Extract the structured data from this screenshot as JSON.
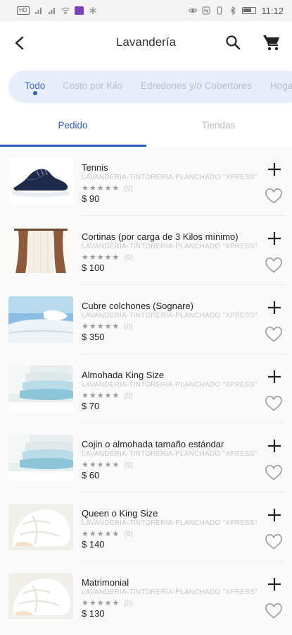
{
  "status_bar": {
    "left_badge": "HD",
    "time": "11:12"
  },
  "header": {
    "title": "Lavandería",
    "back_icon": "chevron-left-icon",
    "search_icon": "search-icon",
    "cart_icon": "cart-icon"
  },
  "categories": [
    {
      "label": "Todo",
      "active": true
    },
    {
      "label": "Costo por Kilo",
      "active": false
    },
    {
      "label": "Edredones y/o Cobertores",
      "active": false
    },
    {
      "label": "Hoga",
      "active": false
    }
  ],
  "tabs": [
    {
      "label": "Pedido",
      "active": true
    },
    {
      "label": "Tiendas",
      "active": false
    }
  ],
  "colors": {
    "accent": "#2d5cb8",
    "chip_bg": "#e7eefa",
    "stars": "#9a9a9a"
  },
  "products": [
    {
      "name": "Tennis",
      "store": "LAVANDERIA-TINTORERIA-PLANCHADO \"XPRESS\"",
      "stars": "★★★★★",
      "reviews": "(0)",
      "price": "$ 90",
      "image": "sneaker"
    },
    {
      "name": "Cortinas (por carga de 3 Kilos mínimo)",
      "store": "LAVANDERIA-TINTORERIA-PLANCHADO \"XPRESS\"",
      "stars": "★★★★★",
      "reviews": "(0)",
      "price": "$ 100",
      "image": "curtains"
    },
    {
      "name": "Cubre colchones (Sognare)",
      "store": "LAVANDERIA-TINTORERIA-PLANCHADO \"XPRESS\"",
      "stars": "★★★★★",
      "reviews": "(0)",
      "price": "$ 350",
      "image": "bed"
    },
    {
      "name": "Almohada King Size",
      "store": "LAVANDERIA-TINTORERIA-PLANCHADO \"XPRESS\"",
      "stars": "★★★★★",
      "reviews": "(0)",
      "price": "$ 70",
      "image": "pillows"
    },
    {
      "name": "Cojin o almohada tamaño estándar",
      "store": "LAVANDERIA-TINTORERIA-PLANCHADO \"XPRESS\"",
      "stars": "★★★★★",
      "reviews": "(0)",
      "price": "$ 60",
      "image": "pillows"
    },
    {
      "name": "Queen o King Size",
      "store": "LAVANDERIA-TINTORERIA-PLANCHADO \"XPRESS\"",
      "stars": "★★★★★",
      "reviews": "(0)",
      "price": "$ 140",
      "image": "duvet"
    },
    {
      "name": "Matrimonial",
      "store": "LAVANDERIA-TINTORERIA-PLANCHADO \"XPRESS\"",
      "stars": "★★★★★",
      "reviews": "(0)",
      "price": "$ 130",
      "image": "duvet"
    }
  ]
}
